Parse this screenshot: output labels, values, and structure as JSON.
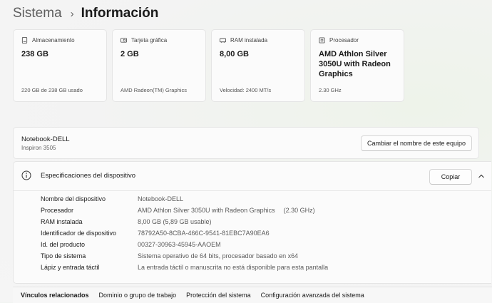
{
  "breadcrumb": {
    "parent": "Sistema",
    "separator": "›",
    "current": "Información"
  },
  "cards": [
    {
      "icon": "storage-icon",
      "label": "Almacenamiento",
      "value": "238 GB",
      "sub": "220 GB de 238 GB usado"
    },
    {
      "icon": "graphics-card-icon",
      "label": "Tarjeta gráfica",
      "value": "2 GB",
      "sub": "AMD Radeon(TM) Graphics"
    },
    {
      "icon": "ram-icon",
      "label": "RAM instalada",
      "value": "8,00 GB",
      "sub": "Velocidad: 2400 MT/s"
    },
    {
      "icon": "processor-icon",
      "label": "Procesador",
      "value": "AMD Athlon Silver 3050U with Radeon Graphics",
      "sub": "2.30 GHz"
    }
  ],
  "device": {
    "name": "Notebook-DELL",
    "model": "Inspiron 3505",
    "rename_button": "Cambiar el nombre de este equipo"
  },
  "specs": {
    "title": "Especificaciones del dispositivo",
    "copy_button": "Copiar",
    "rows": [
      {
        "label": "Nombre del dispositivo",
        "value": "Notebook-DELL"
      },
      {
        "label": "Procesador",
        "value": "AMD Athlon Silver 3050U with Radeon Graphics",
        "extra": "(2.30 GHz)"
      },
      {
        "label": "RAM instalada",
        "value": "8,00 GB (5,89 GB usable)"
      },
      {
        "label": "Identificador de dispositivo",
        "value": "78792A50-8CBA-466C-9541-81EBC7A90EA6"
      },
      {
        "label": "Id. del producto",
        "value": "00327-30963-45945-AAOEM"
      },
      {
        "label": "Tipo de sistema",
        "value": "Sistema operativo de 64 bits, procesador basado en x64"
      },
      {
        "label": "Lápiz y entrada táctil",
        "value": "La entrada táctil o manuscrita no está disponible para esta pantalla"
      }
    ]
  },
  "related": {
    "title": "Vínculos relacionados",
    "links": [
      "Dominio o grupo de trabajo",
      "Protección del sistema",
      "Configuración avanzada del sistema"
    ]
  }
}
